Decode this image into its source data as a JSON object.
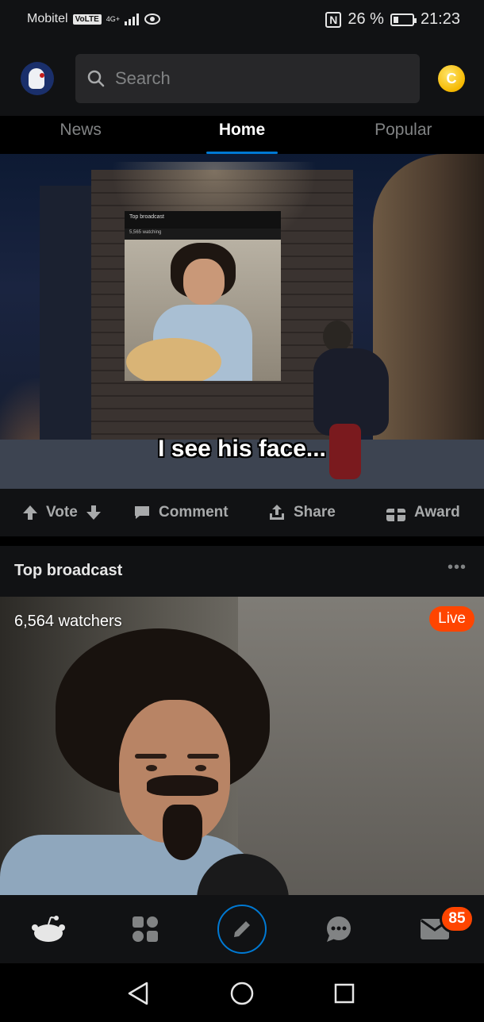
{
  "status_bar": {
    "carrier": "Mobitel",
    "volte": "VoLTE",
    "network": "4G+",
    "nfc": "N",
    "battery": "26 %",
    "battery_level": 0.26,
    "time": "21:23"
  },
  "header": {
    "search_placeholder": "Search",
    "coin_letter": "C"
  },
  "tabs": [
    {
      "label": "News",
      "active": false
    },
    {
      "label": "Home",
      "active": true
    },
    {
      "label": "Popular",
      "active": false
    }
  ],
  "post": {
    "caption": "I see his face...",
    "inset_title": "Top broadcast",
    "inset_sub": "5,565 watching",
    "actions": {
      "vote": "Vote",
      "comment": "Comment",
      "share": "Share",
      "award": "Award"
    }
  },
  "broadcast": {
    "title": "Top broadcast",
    "more": "•••",
    "watchers": "6,564 watchers",
    "live": "Live"
  },
  "bottom_nav": {
    "inbox_badge": "85",
    "items": [
      "home-icon",
      "discover-icon",
      "create-post-icon",
      "chat-icon",
      "inbox-icon"
    ]
  },
  "colors": {
    "accent": "#0079d3",
    "live": "#ff4500",
    "badge": "#ff4500",
    "coin": "#f5b800"
  }
}
